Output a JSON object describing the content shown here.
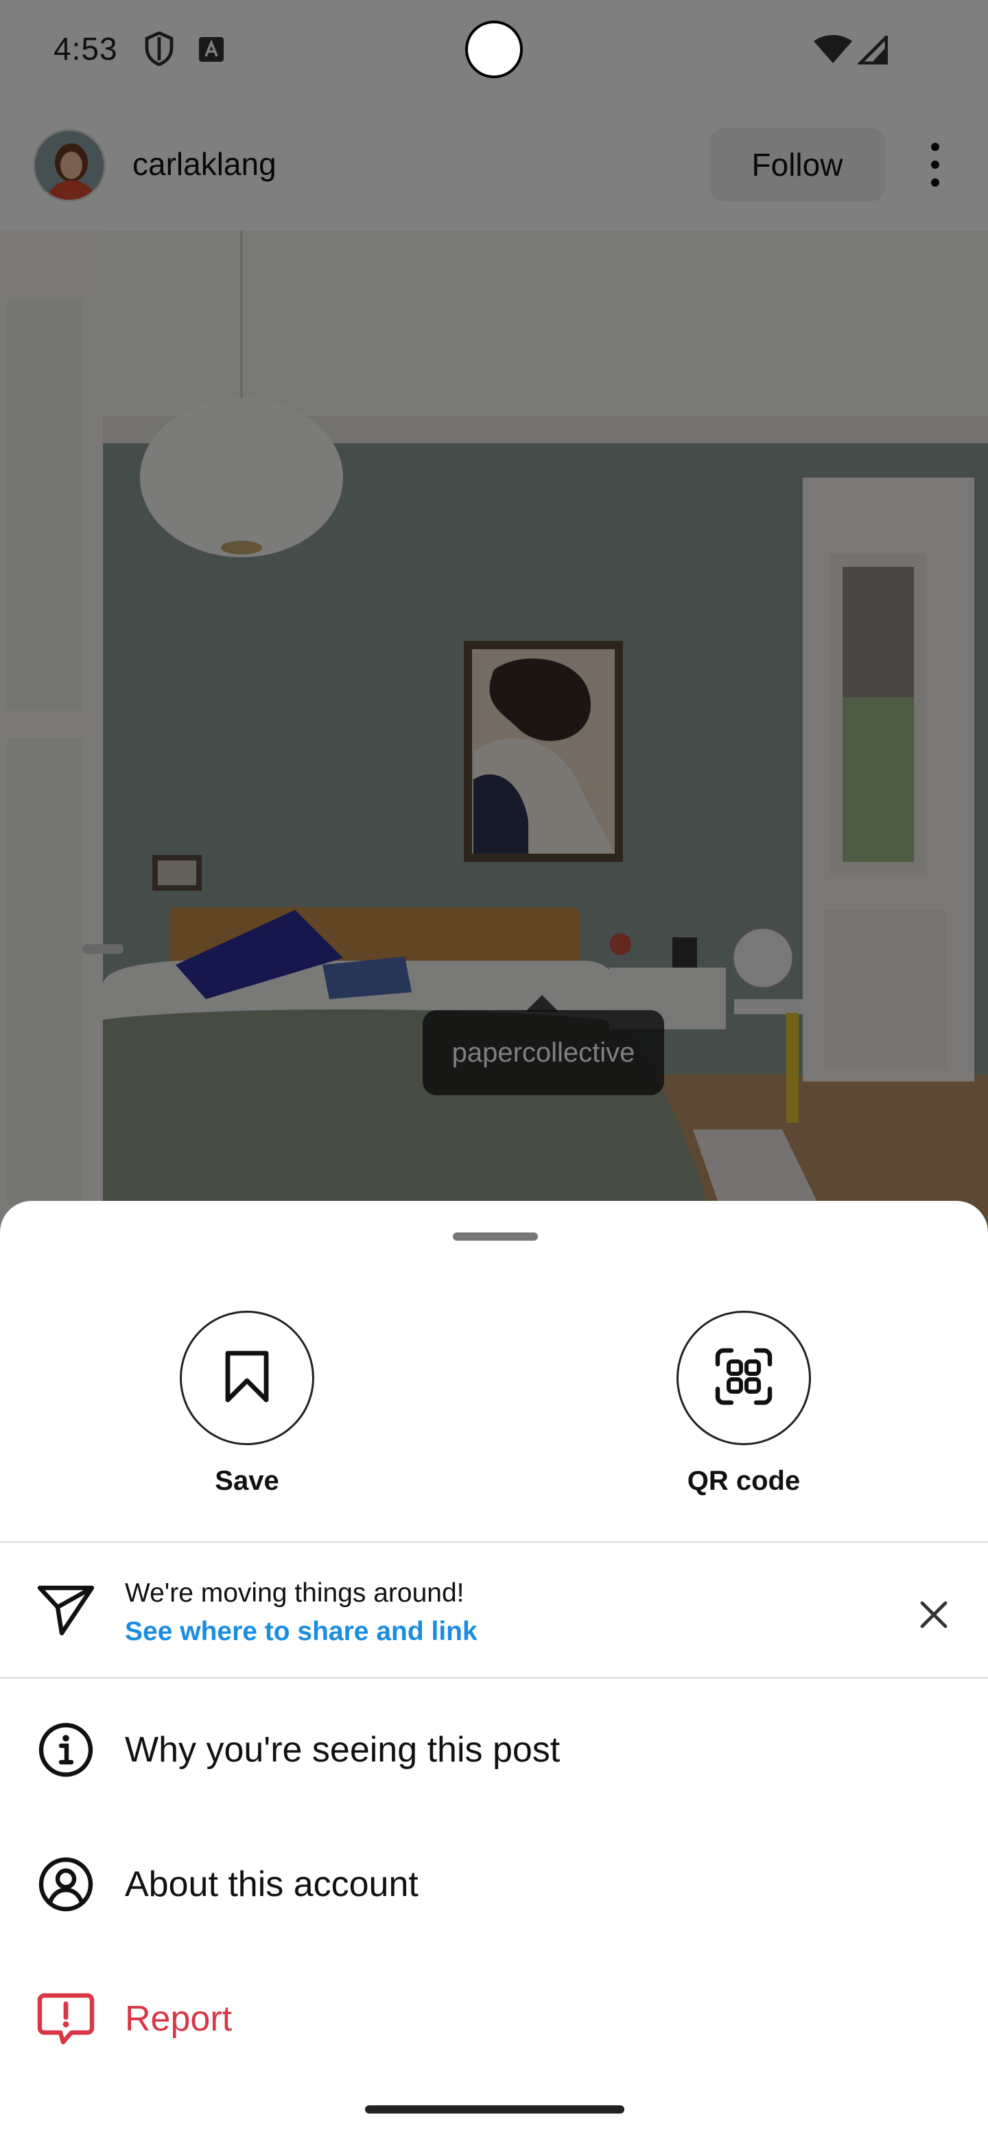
{
  "status_bar": {
    "time": "4:53",
    "icons": [
      "shield-icon",
      "a-badge-icon",
      "wifi-icon",
      "signal-icon"
    ]
  },
  "post": {
    "username": "carlaklang",
    "follow_label": "Follow",
    "tag_label": "papercollective"
  },
  "sheet": {
    "quick_actions": [
      {
        "label": "Save",
        "icon": "bookmark-icon"
      },
      {
        "label": "QR code",
        "icon": "qr-code-icon"
      }
    ],
    "notice": {
      "title": "We're moving things around!",
      "link": "See where to share and link",
      "icon": "paper-plane-icon"
    },
    "menu": [
      {
        "label": "Why you're seeing this post",
        "icon": "info-icon"
      },
      {
        "label": "About this account",
        "icon": "account-icon"
      },
      {
        "label": "Report",
        "icon": "report-icon",
        "color": "#d93646"
      }
    ]
  },
  "colors": {
    "accent_link": "#1a8de0",
    "danger": "#d93646",
    "scrim": "rgba(0,0,0,0.5)"
  }
}
